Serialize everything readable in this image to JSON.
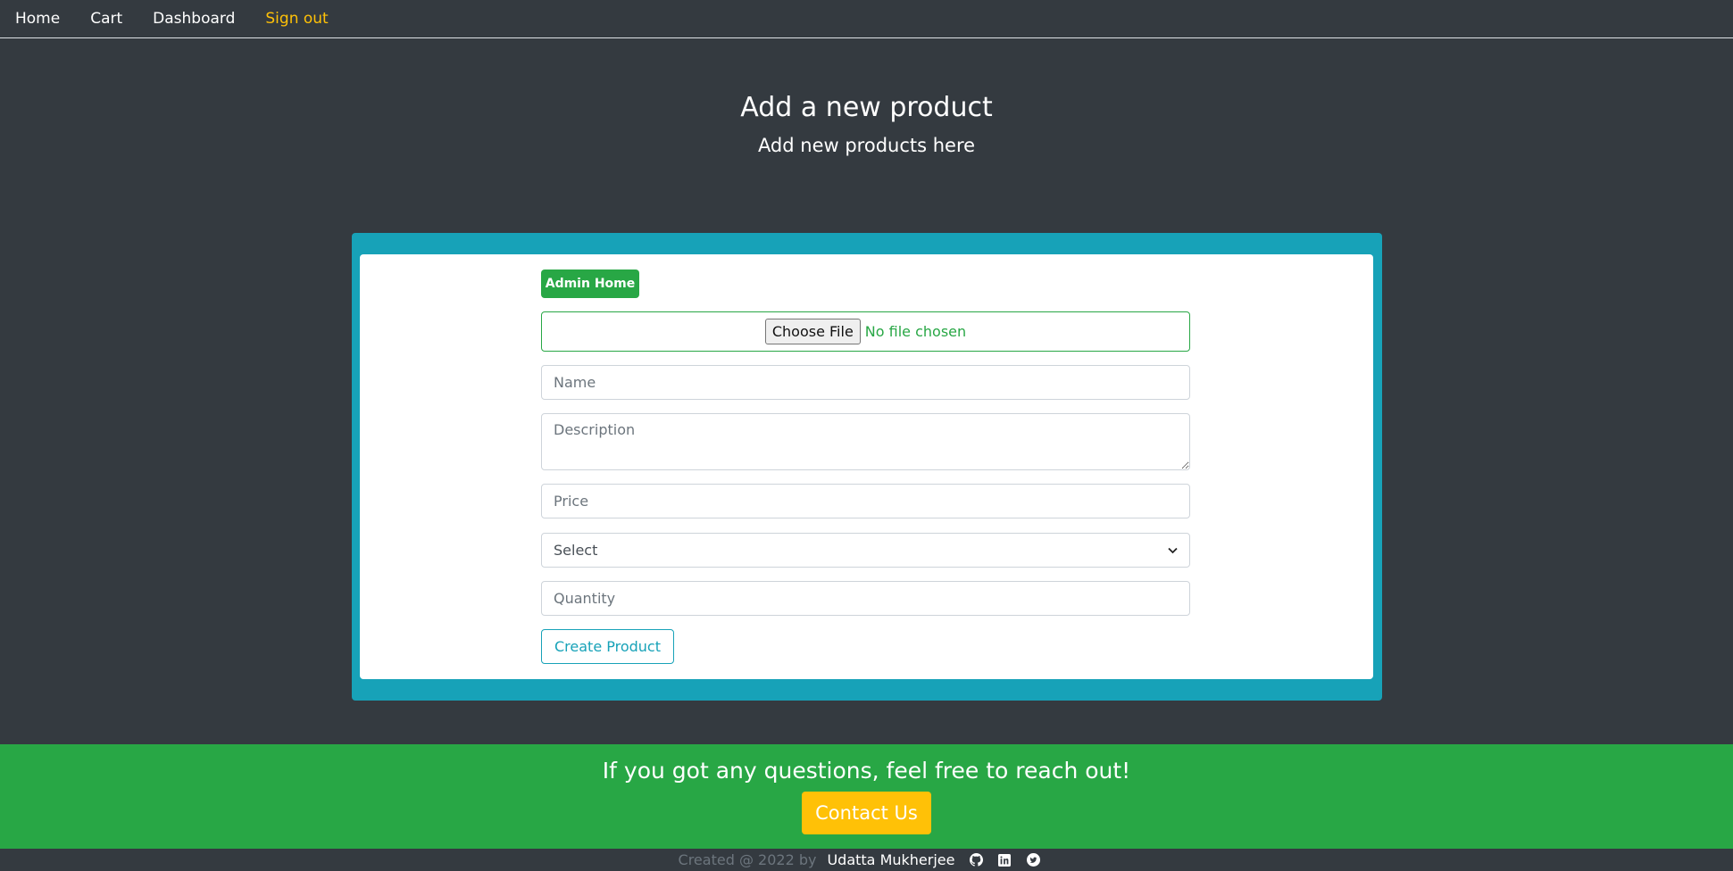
{
  "nav": {
    "items": [
      {
        "label": "Home"
      },
      {
        "label": "Cart"
      },
      {
        "label": "Dashboard"
      },
      {
        "label": "Sign out"
      }
    ]
  },
  "header": {
    "title": "Add a new product",
    "subtitle": "Add new products here"
  },
  "form": {
    "admin_home_label": "Admin Home",
    "file": {
      "button_label": "Choose File",
      "status": "No file chosen"
    },
    "name_placeholder": "Name",
    "description_placeholder": "Description",
    "price_placeholder": "Price",
    "category_selected": "Select",
    "quantity_placeholder": "Quantity",
    "submit_label": "Create Product"
  },
  "cta": {
    "text": "If you got any questions, feel free to reach out!",
    "button_label": "Contact Us"
  },
  "footer": {
    "created_text": "Created @ 2022 by",
    "author": "Udatta Mukherjee",
    "icons": [
      "github-icon",
      "linkedin-icon",
      "twitter-icon"
    ]
  },
  "colors": {
    "background": "#343a40",
    "accent_teal": "#17a2b8",
    "success_green": "#28a745",
    "warning_yellow": "#ffc107"
  }
}
